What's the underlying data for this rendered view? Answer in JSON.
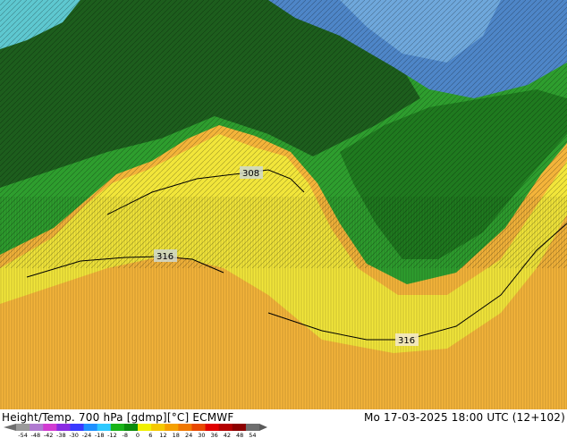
{
  "map": {
    "contour_labels": [
      {
        "text": "308"
      },
      {
        "text": "316"
      },
      {
        "text": "316"
      }
    ]
  },
  "footer": {
    "title": "Height/Temp. 700 hPa [gdmp][°C] ECMWF",
    "datetime": "Mo 17-03-2025 18:00 UTC (12+102)"
  },
  "legend": {
    "ticks": [
      "-54",
      "-48",
      "-42",
      "-38",
      "-30",
      "-24",
      "-18",
      "-12",
      "-8",
      "0",
      "6",
      "12",
      "18",
      "24",
      "30",
      "36",
      "42",
      "48",
      "54"
    ],
    "colors": [
      "#9a9a9a",
      "#b07ad0",
      "#d23cd2",
      "#8a2be2",
      "#3a3aff",
      "#1e90ff",
      "#2ec9ff",
      "#19b419",
      "#0c8c0c",
      "#f0f000",
      "#f5c800",
      "#f5a000",
      "#f07800",
      "#e84800",
      "#e00000",
      "#b40000",
      "#8c0000",
      "#6e6e6e"
    ],
    "accent_colors": {
      "deep_green": "#1d5e1d",
      "mid_green": "#2e9e2e",
      "yellow": "#f2e63a",
      "orange": "#f4b43a",
      "blue": "#4e86c8"
    }
  }
}
